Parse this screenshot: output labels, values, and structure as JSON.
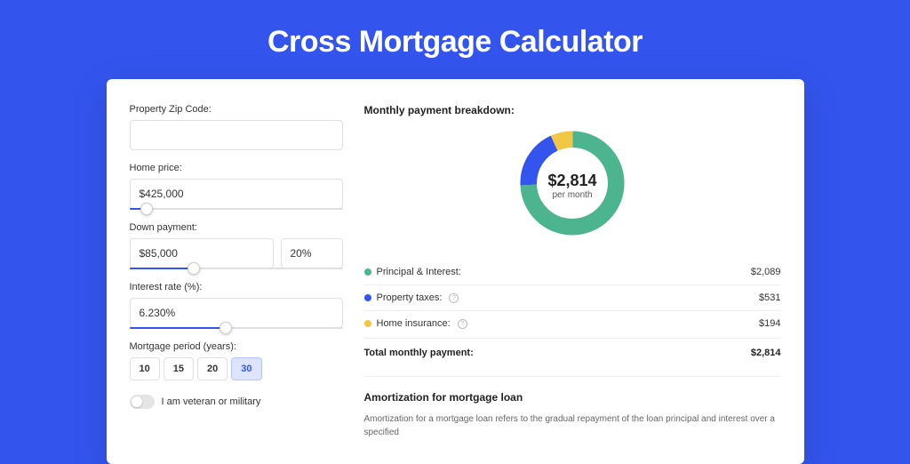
{
  "title": "Cross Mortgage Calculator",
  "form": {
    "zip_label": "Property Zip Code:",
    "zip_value": "",
    "home_price_label": "Home price:",
    "home_price_value": "$425,000",
    "home_price_slider_pct": 8,
    "down_payment_label": "Down payment:",
    "down_payment_value": "$85,000",
    "down_payment_pct": "20%",
    "down_payment_slider_pct": 30,
    "interest_label": "Interest rate (%):",
    "interest_value": "6.230%",
    "interest_slider_pct": 45,
    "period_label": "Mortgage period (years):",
    "periods": [
      "10",
      "15",
      "20",
      "30"
    ],
    "period_selected": "30",
    "veteran_label": "I am veteran or military"
  },
  "breakdown": {
    "title": "Monthly payment breakdown:",
    "center_amount": "$2,814",
    "center_sub": "per month",
    "items": [
      {
        "label": "Principal & Interest:",
        "amount": "$2,089",
        "color": "#4cb58f",
        "info": false
      },
      {
        "label": "Property taxes:",
        "amount": "$531",
        "color": "#3355ee",
        "info": true
      },
      {
        "label": "Home insurance:",
        "amount": "$194",
        "color": "#f2c744",
        "info": true
      }
    ],
    "total_label": "Total monthly payment:",
    "total_amount": "$2,814"
  },
  "chart_data": {
    "type": "pie",
    "title": "Monthly payment breakdown",
    "series": [
      {
        "name": "Principal & Interest",
        "value": 2089,
        "color": "#4cb58f"
      },
      {
        "name": "Property taxes",
        "value": 531,
        "color": "#3355ee"
      },
      {
        "name": "Home insurance",
        "value": 194,
        "color": "#f2c744"
      }
    ],
    "total": 2814,
    "center_label": "$2,814 per month"
  },
  "amortization": {
    "title": "Amortization for mortgage loan",
    "text": "Amortization for a mortgage loan refers to the gradual repayment of the loan principal and interest over a specified"
  }
}
